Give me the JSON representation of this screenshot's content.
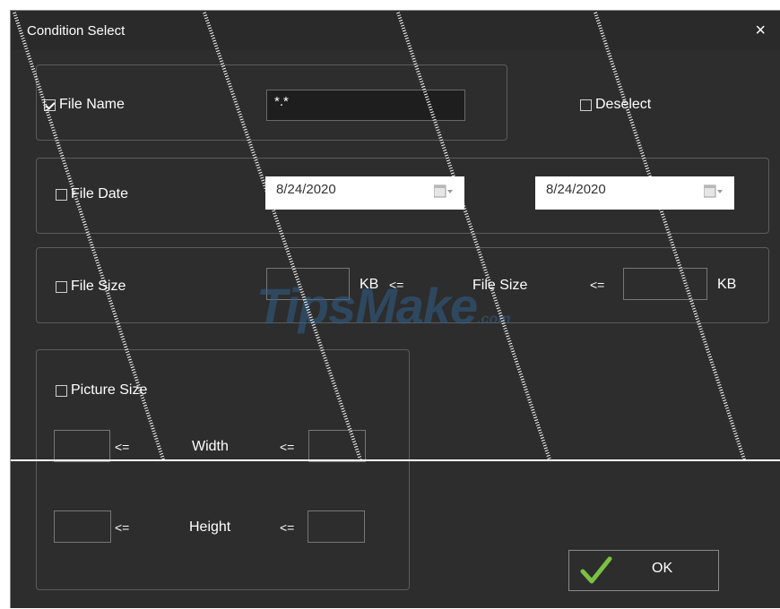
{
  "dialog": {
    "title": "Condition Select",
    "close_glyph": "×"
  },
  "file_name": {
    "checkbox_label": "File Name",
    "checked": true,
    "value": "*.*"
  },
  "deselect": {
    "label": "Deselect",
    "checked": false
  },
  "file_date": {
    "checkbox_label": "File Date",
    "checked": false,
    "from": "8/24/2020",
    "to": "8/24/2020"
  },
  "file_size": {
    "checkbox_label": "File Size",
    "checked": false,
    "unit_left": "KB",
    "op_left": "<=",
    "middle_label": "File Size",
    "op_right": "<=",
    "unit_right": "KB"
  },
  "picture_size": {
    "checkbox_label": "Picture Size",
    "checked": false,
    "width_label": "Width",
    "height_label": "Height",
    "op": "<="
  },
  "ok_button": {
    "label": "OK"
  },
  "watermark": {
    "text": "TipsMake",
    "suffix": ".com"
  },
  "colors": {
    "dialog_bg": "#2d2d2d",
    "check_green": "#7ac143"
  }
}
